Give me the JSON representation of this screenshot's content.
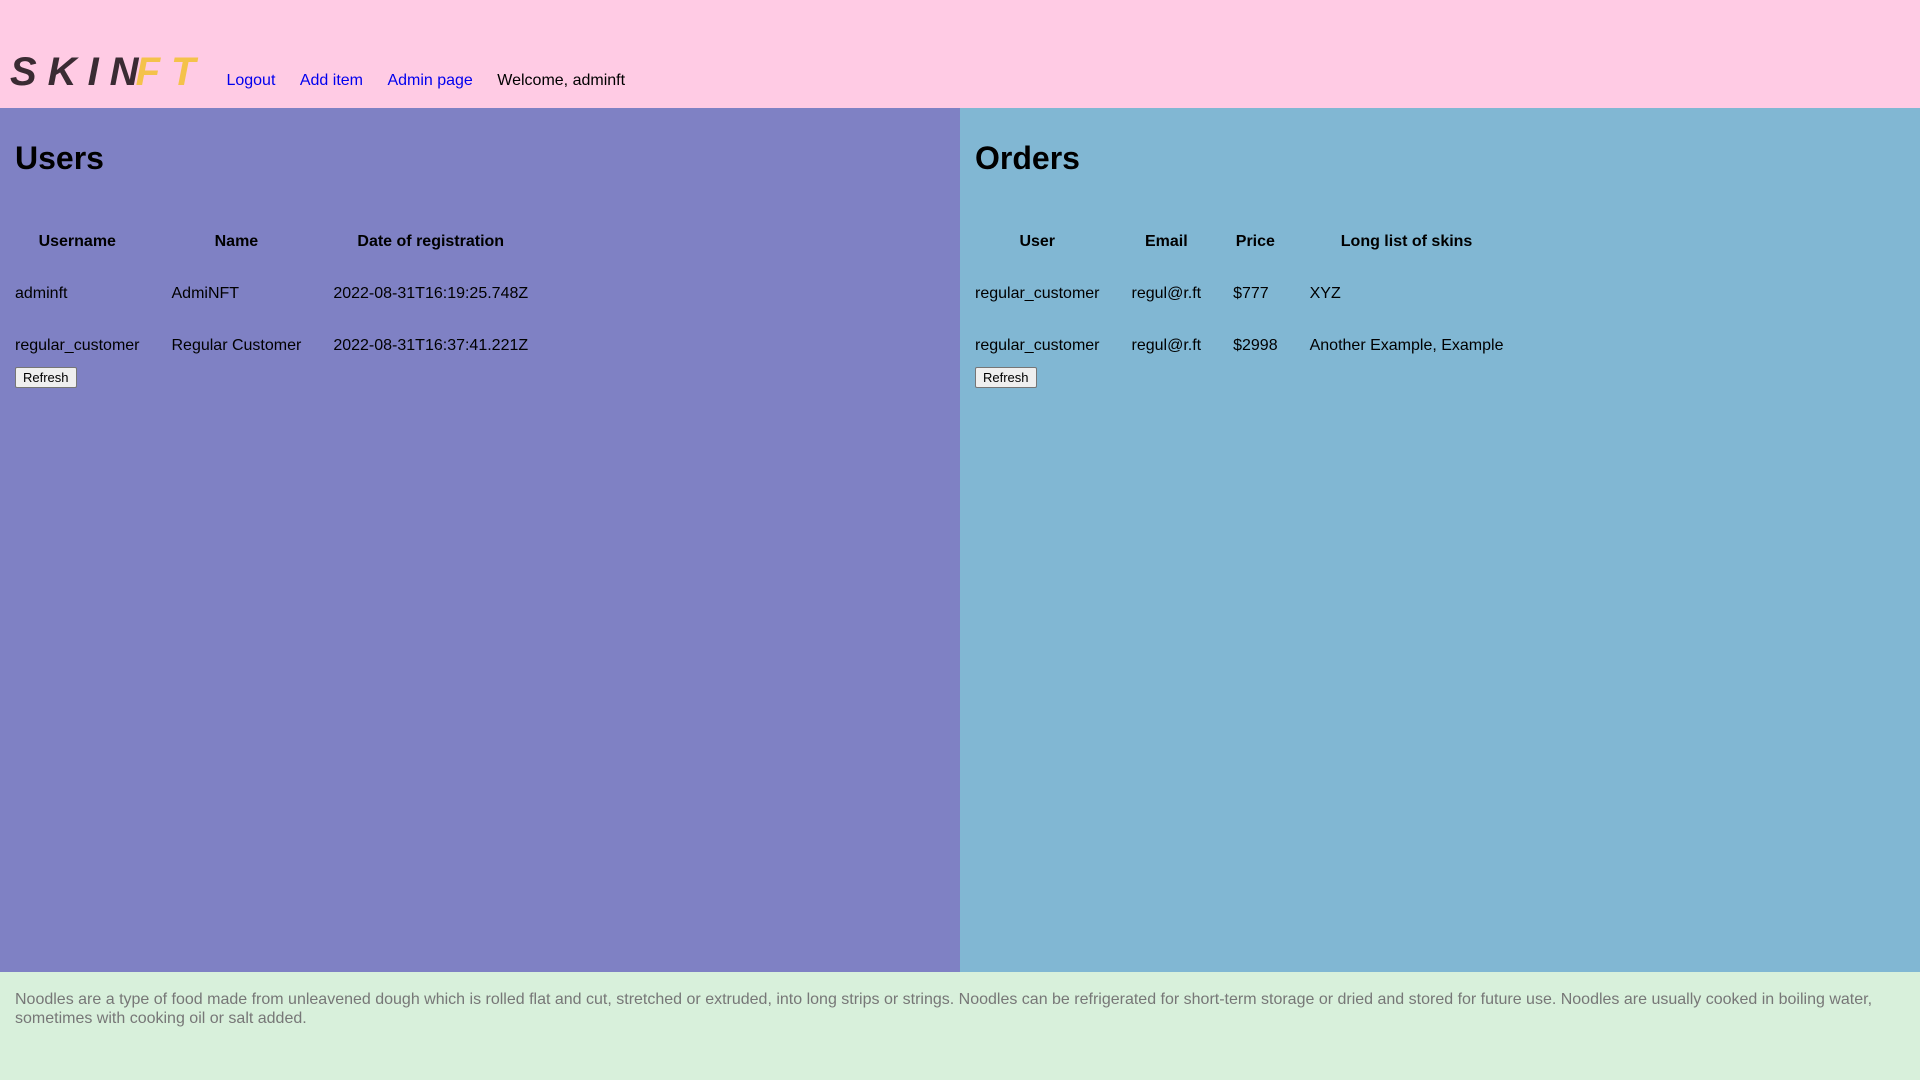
{
  "header": {
    "logo_part1": "SKIN",
    "logo_part2": "FT",
    "nav": {
      "logout": "Logout",
      "add_item": "Add item",
      "admin_page": "Admin page",
      "welcome": "Welcome, adminft"
    }
  },
  "users": {
    "title": "Users",
    "columns": [
      "Username",
      "Name",
      "Date of registration"
    ],
    "rows": [
      [
        "adminft",
        "AdmiNFT",
        "2022-08-31T16:19:25.748Z"
      ],
      [
        "regular_customer",
        "Regular Customer",
        "2022-08-31T16:37:41.221Z"
      ]
    ],
    "refresh_label": "Refresh"
  },
  "orders": {
    "title": "Orders",
    "columns": [
      "User",
      "Email",
      "Price",
      "Long list of skins"
    ],
    "rows": [
      [
        "regular_customer",
        "regul@r.ft",
        "$777",
        "XYZ"
      ],
      [
        "regular_customer",
        "regul@r.ft",
        "$2998",
        "Another Example, Example"
      ]
    ],
    "refresh_label": "Refresh"
  },
  "footer": {
    "text": "Noodles are a type of food made from unleavened dough which is rolled flat and cut, stretched or extruded, into long strips or strings. Noodles can be refrigerated for short-term storage or dried and stored for future use. Noodles are usually cooked in boiling water, sometimes with cooking oil or salt added."
  },
  "colors": {
    "header_bg": "#ffcbe4",
    "users_bg": "#7f81c4",
    "orders_bg": "#81b7d3",
    "footer_bg": "#d8f0db",
    "logo_dark": "#3a2b33",
    "logo_gold": "#f4c24a",
    "link": "#0000ee"
  }
}
